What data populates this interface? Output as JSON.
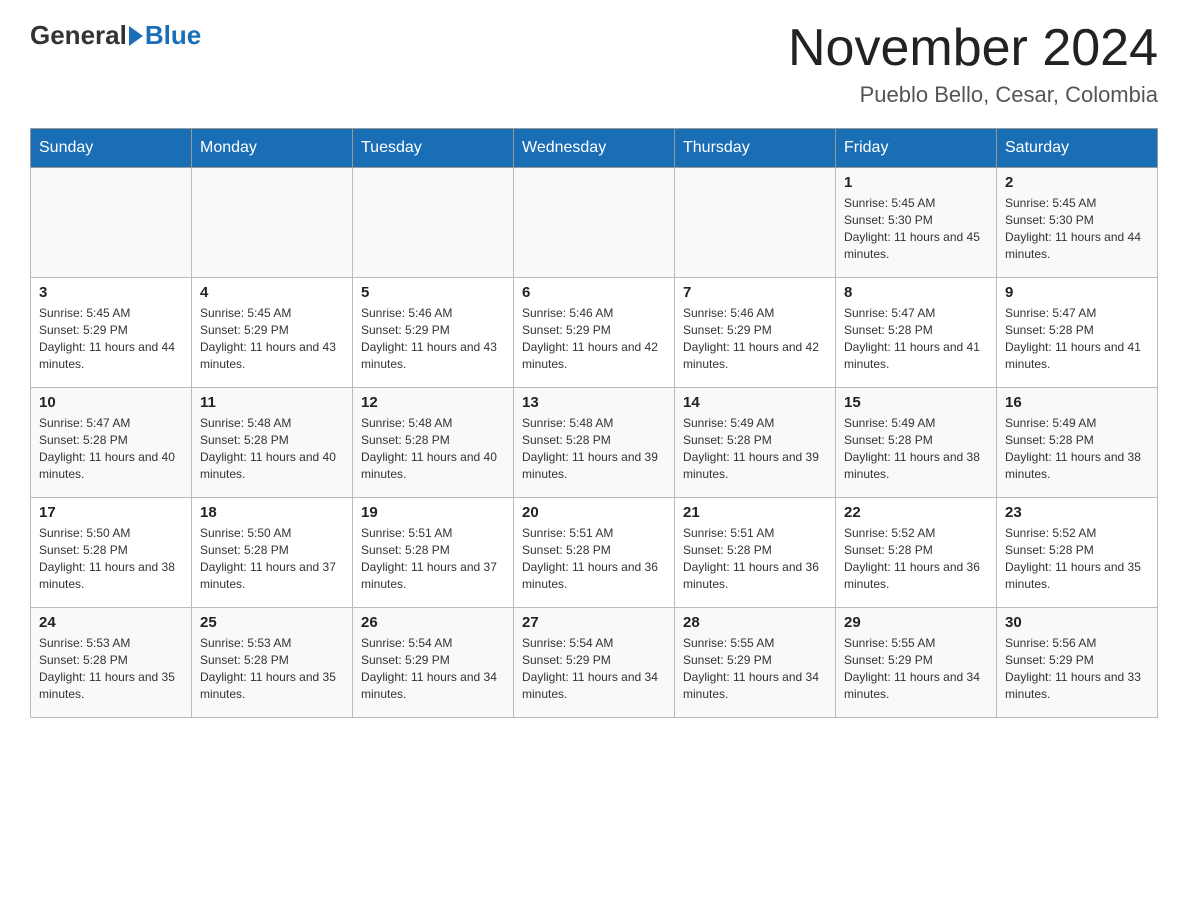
{
  "header": {
    "logo_general": "General",
    "logo_blue": "Blue",
    "month_title": "November 2024",
    "location": "Pueblo Bello, Cesar, Colombia"
  },
  "days_of_week": [
    "Sunday",
    "Monday",
    "Tuesday",
    "Wednesday",
    "Thursday",
    "Friday",
    "Saturday"
  ],
  "weeks": [
    {
      "days": [
        {
          "number": "",
          "sunrise": "",
          "sunset": "",
          "daylight": ""
        },
        {
          "number": "",
          "sunrise": "",
          "sunset": "",
          "daylight": ""
        },
        {
          "number": "",
          "sunrise": "",
          "sunset": "",
          "daylight": ""
        },
        {
          "number": "",
          "sunrise": "",
          "sunset": "",
          "daylight": ""
        },
        {
          "number": "",
          "sunrise": "",
          "sunset": "",
          "daylight": ""
        },
        {
          "number": "1",
          "sunrise": "Sunrise: 5:45 AM",
          "sunset": "Sunset: 5:30 PM",
          "daylight": "Daylight: 11 hours and 45 minutes."
        },
        {
          "number": "2",
          "sunrise": "Sunrise: 5:45 AM",
          "sunset": "Sunset: 5:30 PM",
          "daylight": "Daylight: 11 hours and 44 minutes."
        }
      ]
    },
    {
      "days": [
        {
          "number": "3",
          "sunrise": "Sunrise: 5:45 AM",
          "sunset": "Sunset: 5:29 PM",
          "daylight": "Daylight: 11 hours and 44 minutes."
        },
        {
          "number": "4",
          "sunrise": "Sunrise: 5:45 AM",
          "sunset": "Sunset: 5:29 PM",
          "daylight": "Daylight: 11 hours and 43 minutes."
        },
        {
          "number": "5",
          "sunrise": "Sunrise: 5:46 AM",
          "sunset": "Sunset: 5:29 PM",
          "daylight": "Daylight: 11 hours and 43 minutes."
        },
        {
          "number": "6",
          "sunrise": "Sunrise: 5:46 AM",
          "sunset": "Sunset: 5:29 PM",
          "daylight": "Daylight: 11 hours and 42 minutes."
        },
        {
          "number": "7",
          "sunrise": "Sunrise: 5:46 AM",
          "sunset": "Sunset: 5:29 PM",
          "daylight": "Daylight: 11 hours and 42 minutes."
        },
        {
          "number": "8",
          "sunrise": "Sunrise: 5:47 AM",
          "sunset": "Sunset: 5:28 PM",
          "daylight": "Daylight: 11 hours and 41 minutes."
        },
        {
          "number": "9",
          "sunrise": "Sunrise: 5:47 AM",
          "sunset": "Sunset: 5:28 PM",
          "daylight": "Daylight: 11 hours and 41 minutes."
        }
      ]
    },
    {
      "days": [
        {
          "number": "10",
          "sunrise": "Sunrise: 5:47 AM",
          "sunset": "Sunset: 5:28 PM",
          "daylight": "Daylight: 11 hours and 40 minutes."
        },
        {
          "number": "11",
          "sunrise": "Sunrise: 5:48 AM",
          "sunset": "Sunset: 5:28 PM",
          "daylight": "Daylight: 11 hours and 40 minutes."
        },
        {
          "number": "12",
          "sunrise": "Sunrise: 5:48 AM",
          "sunset": "Sunset: 5:28 PM",
          "daylight": "Daylight: 11 hours and 40 minutes."
        },
        {
          "number": "13",
          "sunrise": "Sunrise: 5:48 AM",
          "sunset": "Sunset: 5:28 PM",
          "daylight": "Daylight: 11 hours and 39 minutes."
        },
        {
          "number": "14",
          "sunrise": "Sunrise: 5:49 AM",
          "sunset": "Sunset: 5:28 PM",
          "daylight": "Daylight: 11 hours and 39 minutes."
        },
        {
          "number": "15",
          "sunrise": "Sunrise: 5:49 AM",
          "sunset": "Sunset: 5:28 PM",
          "daylight": "Daylight: 11 hours and 38 minutes."
        },
        {
          "number": "16",
          "sunrise": "Sunrise: 5:49 AM",
          "sunset": "Sunset: 5:28 PM",
          "daylight": "Daylight: 11 hours and 38 minutes."
        }
      ]
    },
    {
      "days": [
        {
          "number": "17",
          "sunrise": "Sunrise: 5:50 AM",
          "sunset": "Sunset: 5:28 PM",
          "daylight": "Daylight: 11 hours and 38 minutes."
        },
        {
          "number": "18",
          "sunrise": "Sunrise: 5:50 AM",
          "sunset": "Sunset: 5:28 PM",
          "daylight": "Daylight: 11 hours and 37 minutes."
        },
        {
          "number": "19",
          "sunrise": "Sunrise: 5:51 AM",
          "sunset": "Sunset: 5:28 PM",
          "daylight": "Daylight: 11 hours and 37 minutes."
        },
        {
          "number": "20",
          "sunrise": "Sunrise: 5:51 AM",
          "sunset": "Sunset: 5:28 PM",
          "daylight": "Daylight: 11 hours and 36 minutes."
        },
        {
          "number": "21",
          "sunrise": "Sunrise: 5:51 AM",
          "sunset": "Sunset: 5:28 PM",
          "daylight": "Daylight: 11 hours and 36 minutes."
        },
        {
          "number": "22",
          "sunrise": "Sunrise: 5:52 AM",
          "sunset": "Sunset: 5:28 PM",
          "daylight": "Daylight: 11 hours and 36 minutes."
        },
        {
          "number": "23",
          "sunrise": "Sunrise: 5:52 AM",
          "sunset": "Sunset: 5:28 PM",
          "daylight": "Daylight: 11 hours and 35 minutes."
        }
      ]
    },
    {
      "days": [
        {
          "number": "24",
          "sunrise": "Sunrise: 5:53 AM",
          "sunset": "Sunset: 5:28 PM",
          "daylight": "Daylight: 11 hours and 35 minutes."
        },
        {
          "number": "25",
          "sunrise": "Sunrise: 5:53 AM",
          "sunset": "Sunset: 5:28 PM",
          "daylight": "Daylight: 11 hours and 35 minutes."
        },
        {
          "number": "26",
          "sunrise": "Sunrise: 5:54 AM",
          "sunset": "Sunset: 5:29 PM",
          "daylight": "Daylight: 11 hours and 34 minutes."
        },
        {
          "number": "27",
          "sunrise": "Sunrise: 5:54 AM",
          "sunset": "Sunset: 5:29 PM",
          "daylight": "Daylight: 11 hours and 34 minutes."
        },
        {
          "number": "28",
          "sunrise": "Sunrise: 5:55 AM",
          "sunset": "Sunset: 5:29 PM",
          "daylight": "Daylight: 11 hours and 34 minutes."
        },
        {
          "number": "29",
          "sunrise": "Sunrise: 5:55 AM",
          "sunset": "Sunset: 5:29 PM",
          "daylight": "Daylight: 11 hours and 34 minutes."
        },
        {
          "number": "30",
          "sunrise": "Sunrise: 5:56 AM",
          "sunset": "Sunset: 5:29 PM",
          "daylight": "Daylight: 11 hours and 33 minutes."
        }
      ]
    }
  ]
}
